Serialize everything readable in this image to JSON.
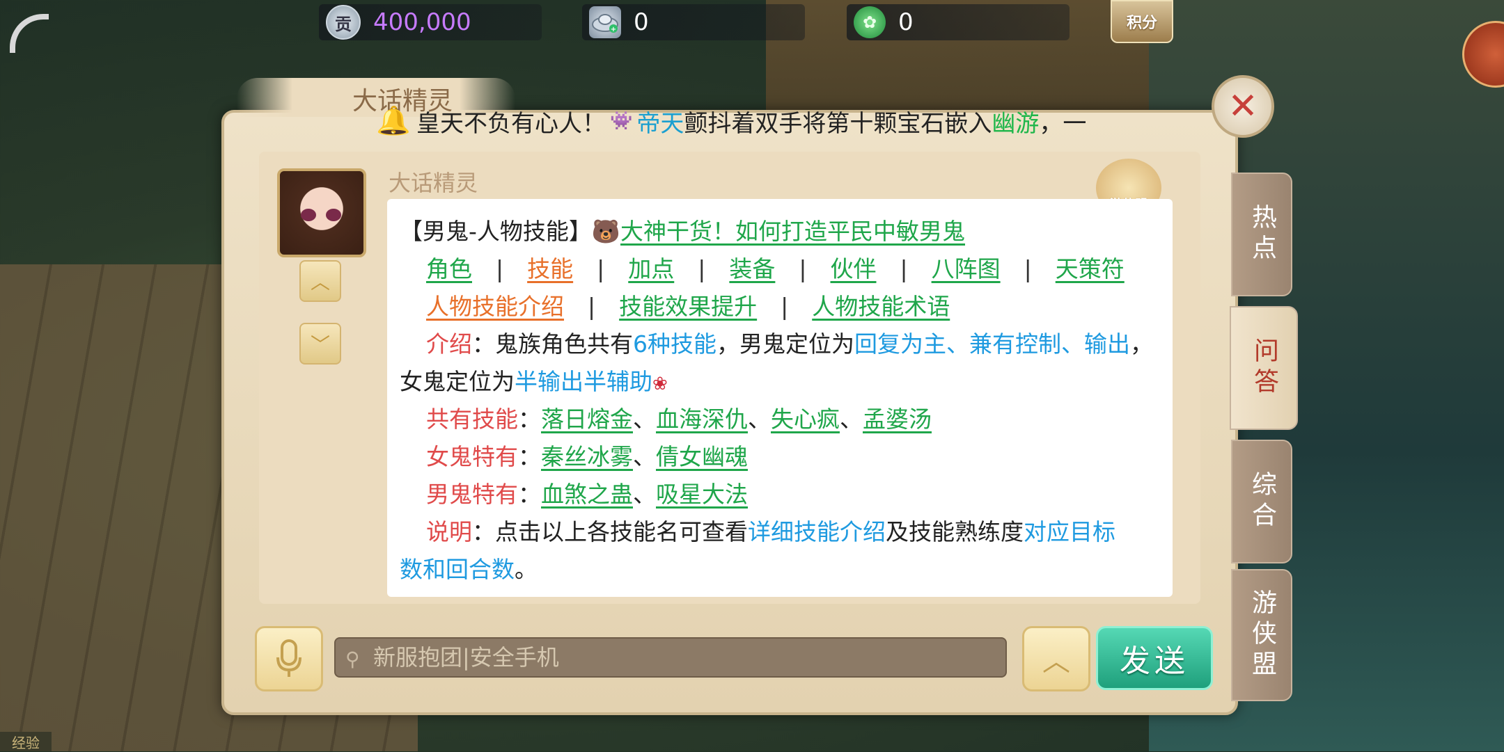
{
  "topbar": {
    "coin": {
      "icon": "gong-coin-icon",
      "glyph": "贡",
      "value": "400,000"
    },
    "silver": {
      "icon": "silver-ingot-icon",
      "value": "0"
    },
    "jade": {
      "icon": "jade-icon",
      "value": "0"
    },
    "score_label": "积分"
  },
  "panel": {
    "tab_title": "大话精灵",
    "marquee": {
      "prefix": "皇天不负有心人！",
      "name1": "帝天",
      "middle": "颤抖着双手将第十颗宝石嵌入",
      "name2": "幽游",
      "suffix": "，一"
    },
    "sender": "大话精灵",
    "youxia_badge": "游侠盟",
    "message": {
      "header_prefix": "【男鬼-人物技能】",
      "header_link": "大神干货！如何打造平民中敏男鬼",
      "nav_row1": [
        "角色",
        "技能",
        "加点",
        "装备",
        "伙伴",
        "八阵图",
        "天策符"
      ],
      "nav_row2": [
        "人物技能介绍",
        "技能效果提升",
        "人物技能术语"
      ],
      "sep": "|",
      "intro_label": "介绍",
      "intro_text1": "鬼族角色共有",
      "intro_hl1": "6种技能",
      "intro_text2": "，男鬼定位为",
      "intro_hl2": "回复为主、兼有控制、输出",
      "intro_text3": "，",
      "intro_text4": "女鬼定位为",
      "intro_hl3": "半输出半辅助",
      "shared_label": "共有技能",
      "shared_skills": [
        "落日熔金",
        "血海深仇",
        "失心疯",
        "孟婆汤"
      ],
      "female_label": "女鬼特有",
      "female_skills": [
        "秦丝冰雾",
        "倩女幽魂"
      ],
      "male_label": "男鬼特有",
      "male_skills": [
        "血煞之蛊",
        "吸星大法"
      ],
      "note_label": "说明",
      "note_text1": "点击以上各技能名可查看",
      "note_hl1": "详细技能介绍",
      "note_text2": "及技能熟练度",
      "note_hl2": "对应目标",
      "note_hl3": "数和回合数",
      "note_end": "。",
      "colon": "：",
      "enum": "、"
    },
    "side_tabs": [
      "热点",
      "问答",
      "综合",
      "游侠盟"
    ],
    "active_tab": "问答"
  },
  "input": {
    "placeholder": "新服抱团|安全手机",
    "send_label": "发送"
  },
  "exp_label": "经验",
  "colors": {
    "link_green": "#1fa64a",
    "link_orange": "#e8702a",
    "label_red": "#e04a4a",
    "highlight_blue": "#1e9ae0",
    "coin_value": "#c77bff",
    "send_button": "#2fbf96"
  }
}
